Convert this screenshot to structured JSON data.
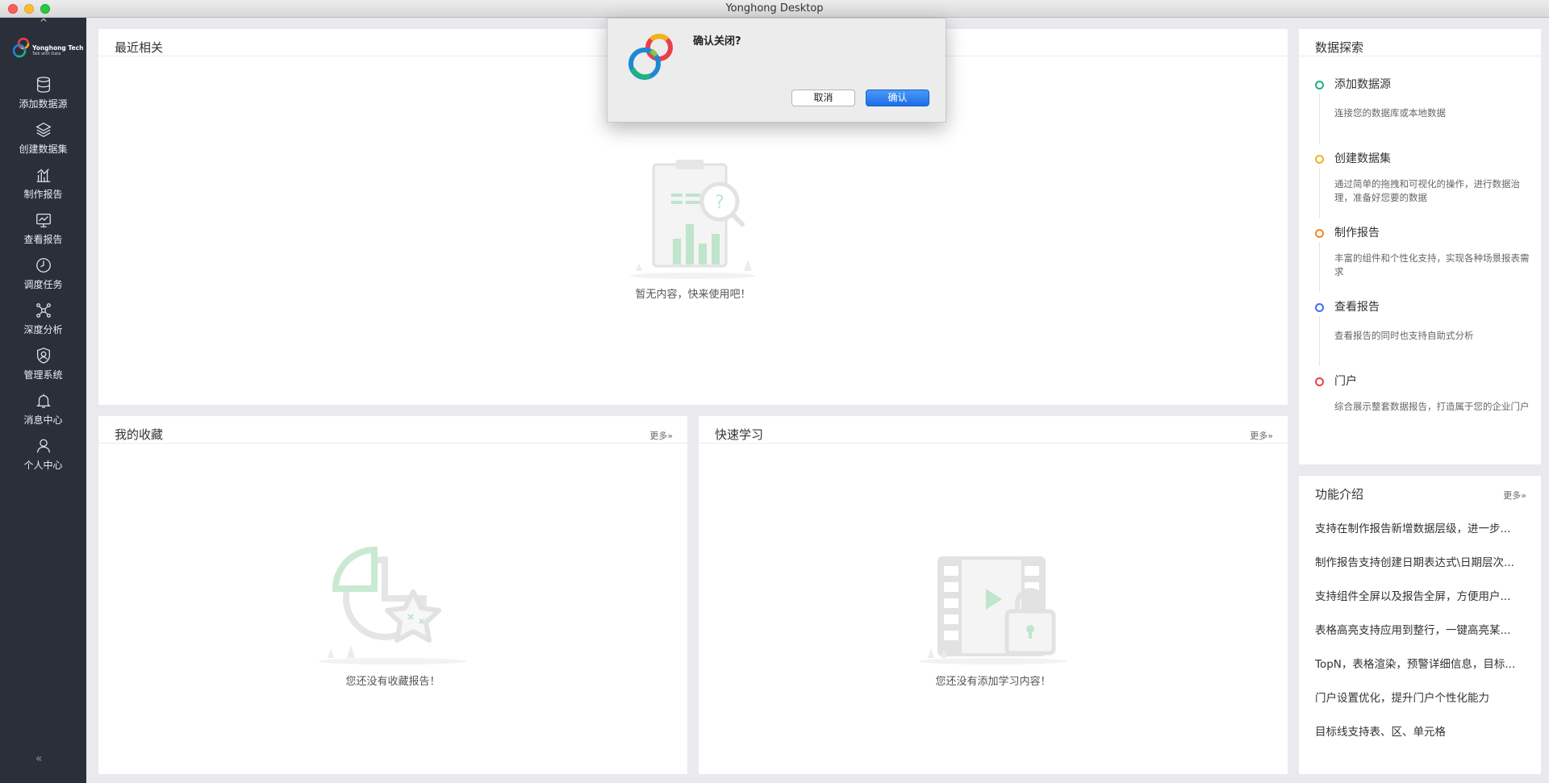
{
  "window": {
    "title": "Yonghong Desktop"
  },
  "brand": {
    "name": "Yonghong Tech",
    "tagline": "Talk with Data"
  },
  "sidebar": {
    "items": [
      {
        "label": "添加数据源",
        "icon": "database-icon"
      },
      {
        "label": "创建数据集",
        "icon": "layers-icon"
      },
      {
        "label": "制作报告",
        "icon": "bar-chart-icon"
      },
      {
        "label": "查看报告",
        "icon": "monitor-chart-icon"
      },
      {
        "label": "调度任务",
        "icon": "clock-task-icon"
      },
      {
        "label": "深度分析",
        "icon": "network-icon"
      },
      {
        "label": "管理系统",
        "icon": "shield-user-icon"
      },
      {
        "label": "消息中心",
        "icon": "bell-icon"
      },
      {
        "label": "个人中心",
        "icon": "user-icon"
      }
    ],
    "collapse_glyph": "«",
    "top_glyph": "^"
  },
  "recent": {
    "title": "最近相关",
    "empty_text": "暂无内容，快来使用吧！"
  },
  "favorites": {
    "title": "我的收藏",
    "more": "更多»",
    "empty_text": "您还没有收藏报告！"
  },
  "learning": {
    "title": "快速学习",
    "more": "更多»",
    "empty_text": "您还没有添加学习内容！"
  },
  "explore": {
    "title": "数据探索",
    "steps": [
      {
        "title": "添加数据源",
        "desc": "连接您的数据库或本地数据",
        "color": "#1fb37a"
      },
      {
        "title": "创建数据集",
        "desc": "通过简单的拖拽和可视化的操作，进行数据治理，准备好您要的数据",
        "color": "#f2b21b"
      },
      {
        "title": "制作报告",
        "desc": "丰富的组件和个性化支持，实现各种场景报表需求",
        "color": "#f08a24"
      },
      {
        "title": "查看报告",
        "desc": "查看报告的同时也支持自助式分析",
        "color": "#3d6ef5"
      },
      {
        "title": "门户",
        "desc": "综合展示整套数据报告，打造属于您的企业门户",
        "color": "#e8404b"
      }
    ]
  },
  "features": {
    "title": "功能介绍",
    "more": "更多»",
    "items": [
      "支持在制作报告新增数据层级，进一步...",
      "制作报告支持创建日期表达式\\日期层次...",
      "支持组件全屏以及报告全屏，方便用户...",
      "表格高亮支持应用到整行，一键高亮某...",
      "TopN，表格渲染，预警详细信息，目标...",
      "门户设置优化，提升门户个性化能力",
      "目标线支持表、区、单元格"
    ]
  },
  "dialog": {
    "message": "确认关闭?",
    "cancel": "取消",
    "confirm": "确认"
  }
}
